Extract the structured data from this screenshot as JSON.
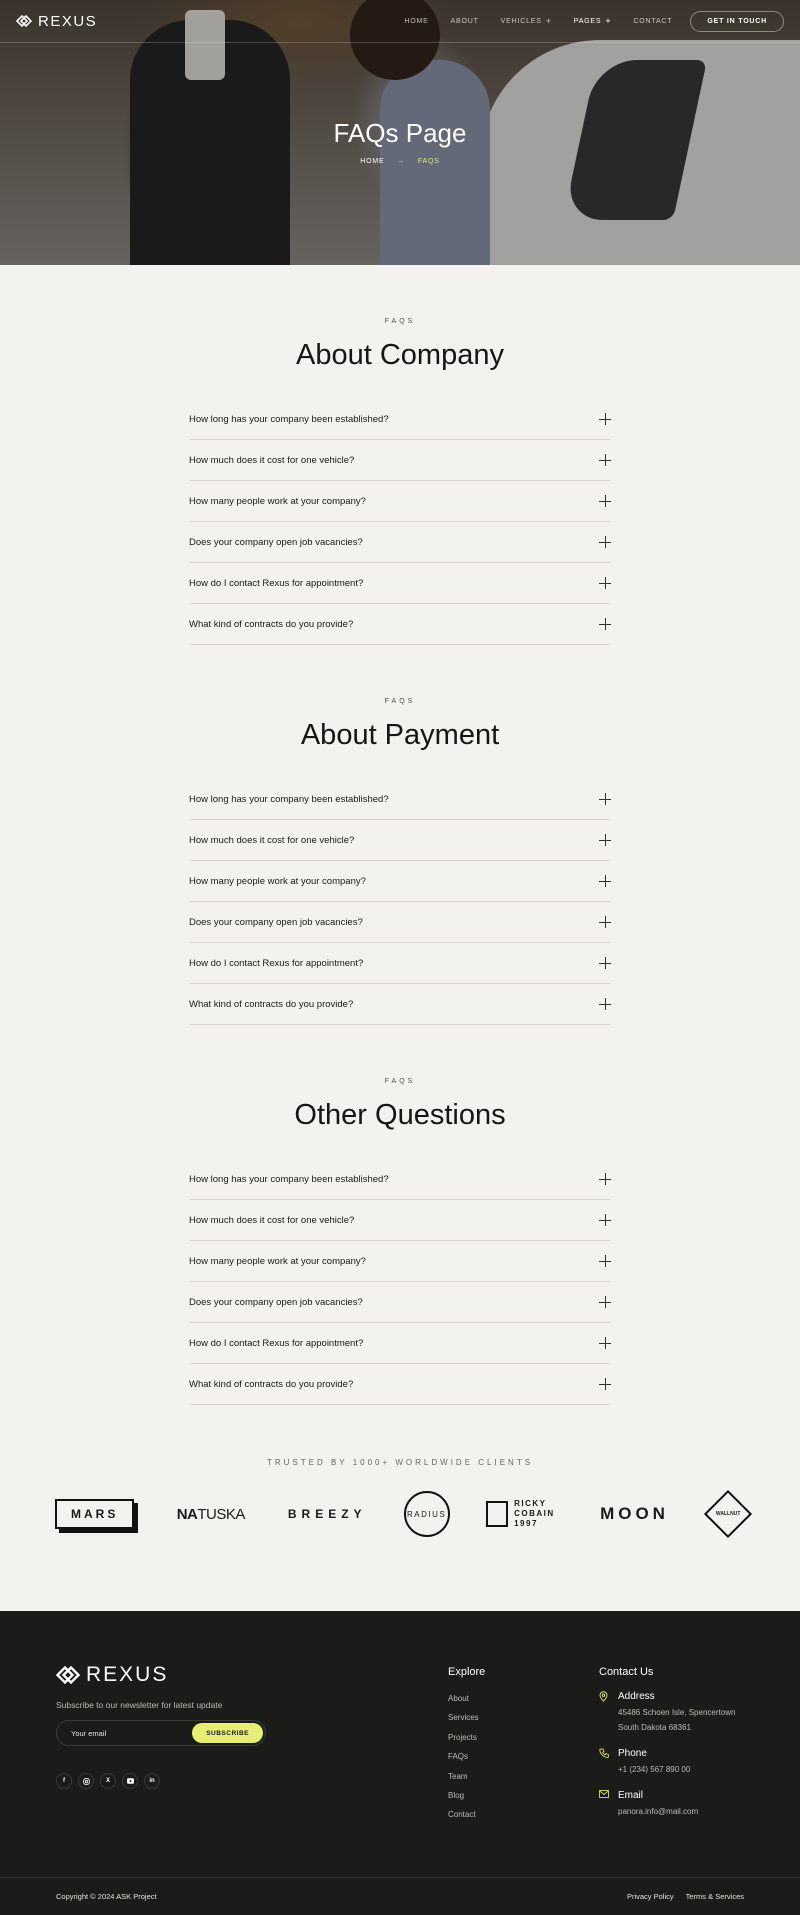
{
  "brand": {
    "name": "REXUS"
  },
  "nav": {
    "items": [
      {
        "label": "HOME"
      },
      {
        "label": "ABOUT"
      },
      {
        "label": "VEHICLES"
      },
      {
        "label": "PAGES"
      },
      {
        "label": "CONTACT"
      }
    ],
    "cta": "GET IN TOUCH"
  },
  "hero": {
    "title": "FAQs Page",
    "breadcrumb": {
      "home": "HOME",
      "separator": "→",
      "current": "FAQS"
    }
  },
  "faq_sections": [
    {
      "eyebrow": "FAQS",
      "title": "About Company",
      "questions": [
        "How long has your company been established?",
        "How much does it cost for one vehicle?",
        "How many people work at your company?",
        "Does your company open job vacancies?",
        "How do I contact Rexus for appointment?",
        "What kind of contracts do you provide?"
      ]
    },
    {
      "eyebrow": "FAQS",
      "title": "About Payment",
      "questions": [
        "How long has your company been established?",
        "How much does it cost for one vehicle?",
        "How many people work at your company?",
        "Does your company open job vacancies?",
        "How do I contact Rexus for appointment?",
        "What kind of contracts do you provide?"
      ]
    },
    {
      "eyebrow": "FAQS",
      "title": "Other Questions",
      "questions": [
        "How long has your company been established?",
        "How much does it cost for one vehicle?",
        "How many people work at your company?",
        "Does your company open job vacancies?",
        "How do I contact Rexus for appointment?",
        "What kind of contracts do you provide?"
      ]
    }
  ],
  "clients": {
    "label": "TRUSTED BY 1000+ WORLDWIDE CLIENTS",
    "logos": {
      "mars": "MARS",
      "natuska_bold": "NA",
      "natuska_rest": "TUSKA",
      "breezy": "BREEZY",
      "radius": "RADIUS",
      "ricky": "RICKY COBAIN 1997",
      "moon": "MOON",
      "wallnut": "WALLNUT"
    }
  },
  "footer": {
    "subscribe_text": "Subscribe to our newsletter for latest update",
    "email_placeholder": "Your email",
    "subscribe_button": "SUBSCRIBE",
    "socials": [
      "f",
      "ig",
      "X",
      "yt",
      "in"
    ],
    "explore": {
      "title": "Explore",
      "links": [
        "About",
        "Services",
        "Projects",
        "FAQs",
        "Team",
        "Blog",
        "Contact"
      ]
    },
    "contact": {
      "title": "Contact Us",
      "address_label": "Address",
      "address_line1": "45486 Schoen Isle, Spencertown",
      "address_line2": "South Dakota 68361",
      "phone_label": "Phone",
      "phone": "+1 (234) 567 890 00",
      "email_label": "Email",
      "email": "panora.info@mail.com"
    },
    "copyright": "Copyright © 2024 ASK Project",
    "legal": [
      "Privacy Policy",
      "Terms & Services"
    ]
  },
  "colors": {
    "accent": "#e8ee72",
    "dark": "#1b1b19",
    "background": "#f4f2ee"
  }
}
